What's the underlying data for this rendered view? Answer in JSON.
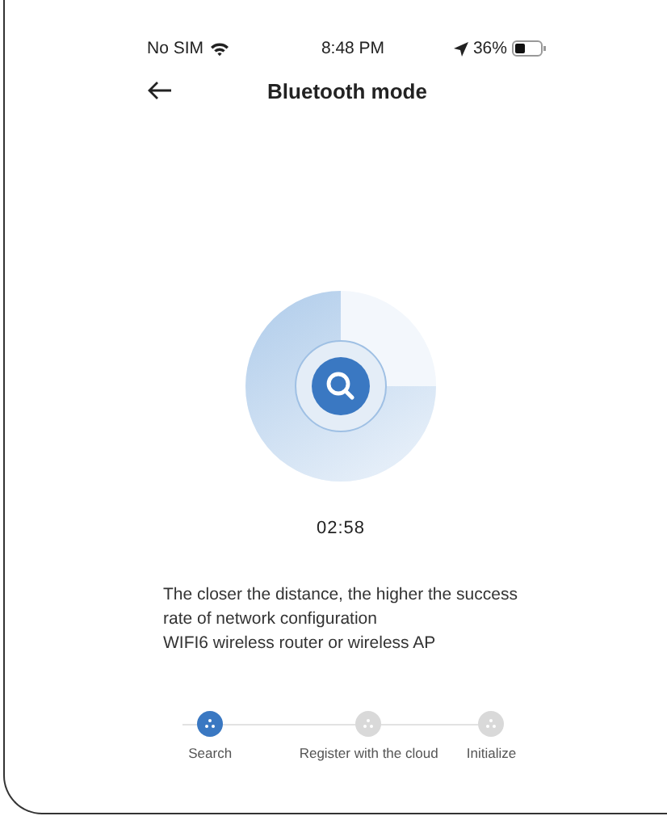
{
  "status_bar": {
    "carrier": "No SIM",
    "time": "8:48 PM",
    "battery": "36%"
  },
  "header": {
    "title": "Bluetooth mode"
  },
  "timer": "02:58",
  "tips": [
    "The closer the distance, the higher the success rate of network configuration",
    "WIFI6 wireless router or wireless AP"
  ],
  "steps": [
    {
      "label": "Search",
      "selected": true
    },
    {
      "label": "Register with the cloud",
      "selected": false
    },
    {
      "label": "Initialize",
      "selected": false
    }
  ]
}
